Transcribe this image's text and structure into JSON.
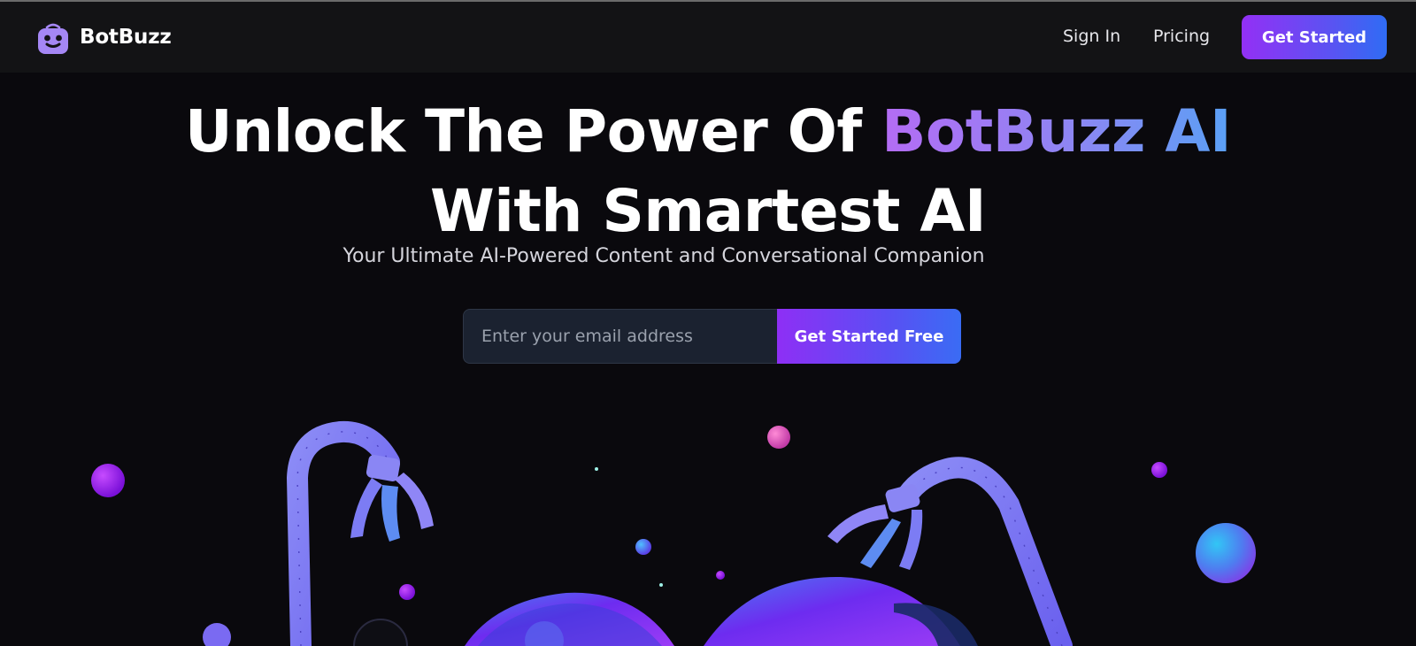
{
  "brand": {
    "name": "BotBuzz",
    "logo_icon": "robot-face-icon"
  },
  "nav": {
    "sign_in": "Sign In",
    "pricing": "Pricing",
    "cta": "Get Started"
  },
  "hero": {
    "title_prefix": "Unlock The Power Of ",
    "title_highlight": "BotBuzz AI",
    "title_line2": "With Smartest AI",
    "subtitle": "Your Ultimate AI-Powered Content and Conversational Companion"
  },
  "signup": {
    "email_placeholder": "Enter your email address",
    "email_value": "",
    "button": "Get Started Free"
  },
  "colors": {
    "background": "#0a090d",
    "navbar": "#131315",
    "accent_purple": "#9330f5",
    "accent_blue": "#2f6cf4",
    "logo": "#a587f5",
    "input_bg": "#1b2230"
  },
  "illustration": {
    "description_icon": "robot-claws-illustration"
  }
}
